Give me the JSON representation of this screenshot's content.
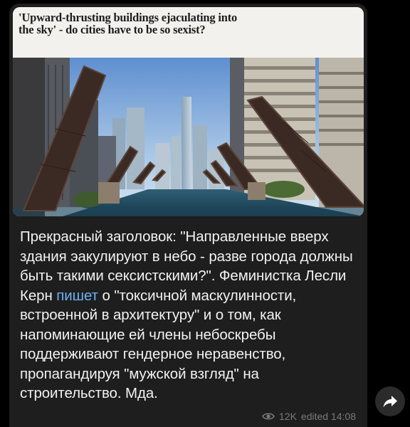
{
  "post": {
    "preview": {
      "headline": "'Upward-thrusting buildings ejaculating into the sky' - do cities have to be so sexist?"
    },
    "text_part1": "Прекрасный заголовок: \"Направленные вверх здания эакулируют в небо - разве города должны быть такими сексистскими?\". Феминистка Лесли Керн ",
    "link_label": "пишет",
    "text_part2": " о \"токсичной маскулинности, встроенной в архитектуру\" и о том, как напоминающие ей члены небоскребы поддерживают гендерное неравенство, пропагандируя \"мужской взгляд\" на строительство. Мда.",
    "views": "12K",
    "edited": "edited 14:08"
  },
  "icons": {
    "views": "eye-icon",
    "share": "share-arrow-icon"
  },
  "colors": {
    "link": "#6ab1f2",
    "bubble": "#1e1e1e",
    "meta": "#7a7a7a"
  }
}
